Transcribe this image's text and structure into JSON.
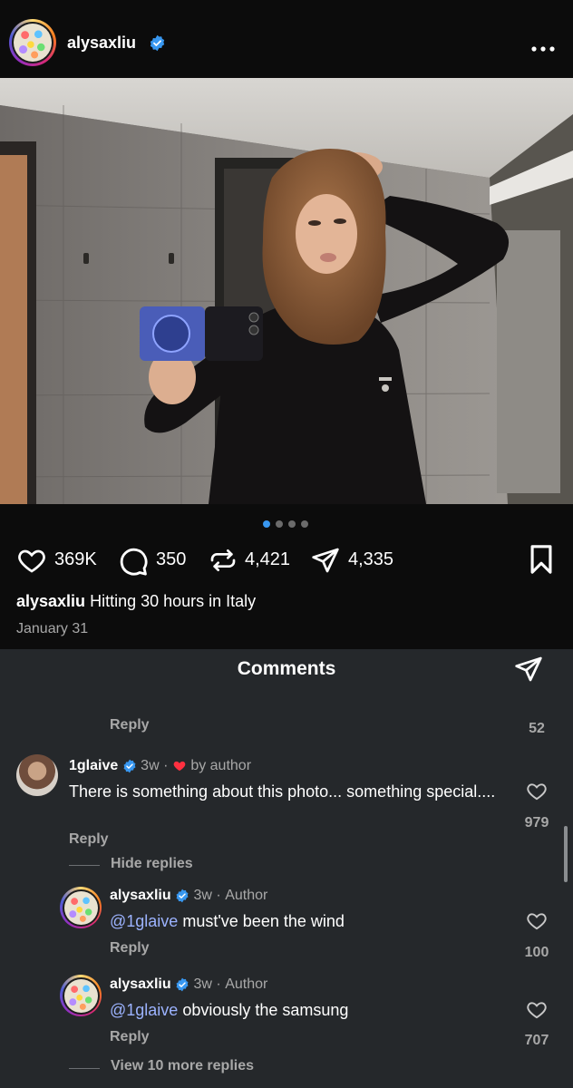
{
  "header": {
    "username": "alysaxliu",
    "more_icon": "more-horizontal-icon"
  },
  "carousel": {
    "total": 4,
    "active": 0
  },
  "actions": {
    "likes": "369K",
    "comments": "350",
    "reposts": "4,421",
    "shares": "4,335"
  },
  "caption": {
    "username": "alysaxliu",
    "text": "Hitting 30 hours in Italy",
    "date": "January 31"
  },
  "comments_sheet": {
    "title": "Comments",
    "prev_reply_label": "Reply",
    "prev_count": "52",
    "comments": [
      {
        "username": "1glaive",
        "time": "3w",
        "liked_by_label": "by author",
        "text": "There is something about this photo... something special....",
        "reply_label": "Reply",
        "likes": "979"
      }
    ],
    "hide_replies": "Hide replies",
    "replies": [
      {
        "username": "alysaxliu",
        "time": "3w",
        "role": "Author",
        "mention": "@1glaive",
        "text": "must've been the wind",
        "reply_label": "Reply",
        "likes": "100"
      },
      {
        "username": "alysaxliu",
        "time": "3w",
        "role": "Author",
        "mention": "@1glaive",
        "text": "obviously the samsung",
        "reply_label": "Reply",
        "likes": "707"
      }
    ],
    "view_more": "View 10 more replies"
  },
  "colors": {
    "verified": "#3897f0",
    "heart_red": "#ff3040",
    "carousel_active": "#3897f0",
    "sheet_bg": "#25282b"
  }
}
